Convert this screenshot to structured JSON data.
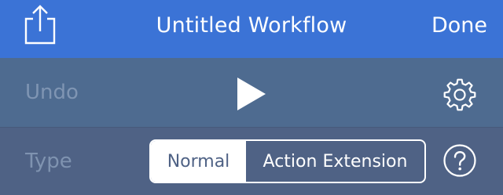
{
  "navbar": {
    "title": "Untitled Workflow",
    "done_label": "Done",
    "share_icon": "share-icon",
    "background": "#3b73d6"
  },
  "toolbar": {
    "undo_label": "Undo",
    "play_icon": "play-icon",
    "settings_icon": "gear-icon"
  },
  "type_row": {
    "label": "Type",
    "segments": [
      {
        "label": "Normal",
        "selected": true
      },
      {
        "label": "Action Extension",
        "selected": false
      }
    ],
    "help_icon": "question-icon"
  }
}
